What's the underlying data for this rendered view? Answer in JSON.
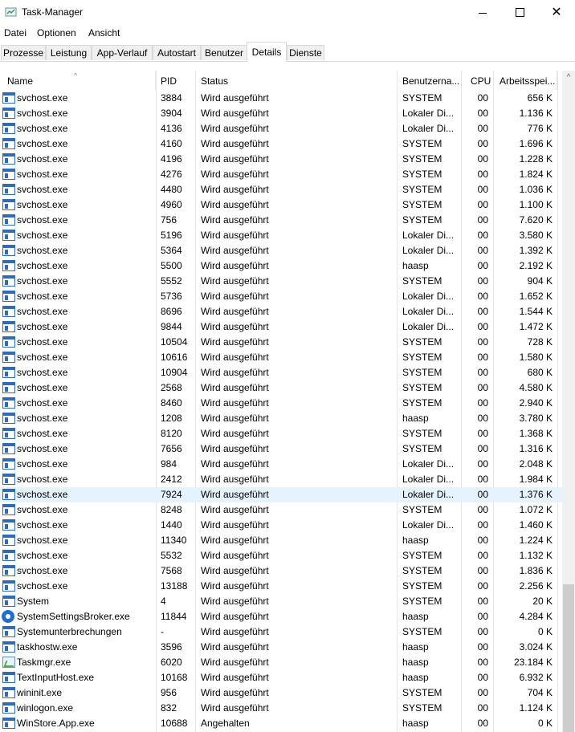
{
  "window": {
    "title": "Task-Manager",
    "app_icon": "task-manager-icon"
  },
  "menu": [
    "Datei",
    "Optionen",
    "Ansicht"
  ],
  "tabs": [
    "Prozesse",
    "Leistung",
    "App-Verlauf",
    "Autostart",
    "Benutzer",
    "Details",
    "Dienste"
  ],
  "active_tab": "Details",
  "columns": {
    "name": "Name",
    "pid": "PID",
    "status": "Status",
    "user": "Benutzerna...",
    "cpu": "CPU",
    "memory": "Arbeitsspei..."
  },
  "colors": {
    "selected_row": "#e5f3ff",
    "icon_blue": "#2f6cb5"
  },
  "rows": [
    {
      "name": "svchost.exe",
      "pid": "3884",
      "status": "Wird ausgeführt",
      "user": "SYSTEM",
      "cpu": "00",
      "mem": "656 K",
      "icon": "window-icon"
    },
    {
      "name": "svchost.exe",
      "pid": "3904",
      "status": "Wird ausgeführt",
      "user": "Lokaler Di...",
      "cpu": "00",
      "mem": "1.136 K",
      "icon": "window-icon"
    },
    {
      "name": "svchost.exe",
      "pid": "4136",
      "status": "Wird ausgeführt",
      "user": "Lokaler Di...",
      "cpu": "00",
      "mem": "776 K",
      "icon": "window-icon"
    },
    {
      "name": "svchost.exe",
      "pid": "4160",
      "status": "Wird ausgeführt",
      "user": "SYSTEM",
      "cpu": "00",
      "mem": "1.696 K",
      "icon": "window-icon"
    },
    {
      "name": "svchost.exe",
      "pid": "4196",
      "status": "Wird ausgeführt",
      "user": "SYSTEM",
      "cpu": "00",
      "mem": "1.228 K",
      "icon": "window-icon"
    },
    {
      "name": "svchost.exe",
      "pid": "4276",
      "status": "Wird ausgeführt",
      "user": "SYSTEM",
      "cpu": "00",
      "mem": "1.824 K",
      "icon": "window-icon"
    },
    {
      "name": "svchost.exe",
      "pid": "4480",
      "status": "Wird ausgeführt",
      "user": "SYSTEM",
      "cpu": "00",
      "mem": "1.036 K",
      "icon": "window-icon"
    },
    {
      "name": "svchost.exe",
      "pid": "4960",
      "status": "Wird ausgeführt",
      "user": "SYSTEM",
      "cpu": "00",
      "mem": "1.100 K",
      "icon": "window-icon"
    },
    {
      "name": "svchost.exe",
      "pid": "756",
      "status": "Wird ausgeführt",
      "user": "SYSTEM",
      "cpu": "00",
      "mem": "7.620 K",
      "icon": "window-icon"
    },
    {
      "name": "svchost.exe",
      "pid": "5196",
      "status": "Wird ausgeführt",
      "user": "Lokaler Di...",
      "cpu": "00",
      "mem": "3.580 K",
      "icon": "window-icon"
    },
    {
      "name": "svchost.exe",
      "pid": "5364",
      "status": "Wird ausgeführt",
      "user": "Lokaler Di...",
      "cpu": "00",
      "mem": "1.392 K",
      "icon": "window-icon"
    },
    {
      "name": "svchost.exe",
      "pid": "5500",
      "status": "Wird ausgeführt",
      "user": "haasp",
      "cpu": "00",
      "mem": "2.192 K",
      "icon": "window-icon"
    },
    {
      "name": "svchost.exe",
      "pid": "5552",
      "status": "Wird ausgeführt",
      "user": "SYSTEM",
      "cpu": "00",
      "mem": "904 K",
      "icon": "window-icon"
    },
    {
      "name": "svchost.exe",
      "pid": "5736",
      "status": "Wird ausgeführt",
      "user": "Lokaler Di...",
      "cpu": "00",
      "mem": "1.652 K",
      "icon": "window-icon"
    },
    {
      "name": "svchost.exe",
      "pid": "8696",
      "status": "Wird ausgeführt",
      "user": "Lokaler Di...",
      "cpu": "00",
      "mem": "1.544 K",
      "icon": "window-icon"
    },
    {
      "name": "svchost.exe",
      "pid": "9844",
      "status": "Wird ausgeführt",
      "user": "Lokaler Di...",
      "cpu": "00",
      "mem": "1.472 K",
      "icon": "window-icon"
    },
    {
      "name": "svchost.exe",
      "pid": "10504",
      "status": "Wird ausgeführt",
      "user": "SYSTEM",
      "cpu": "00",
      "mem": "728 K",
      "icon": "window-icon"
    },
    {
      "name": "svchost.exe",
      "pid": "10616",
      "status": "Wird ausgeführt",
      "user": "SYSTEM",
      "cpu": "00",
      "mem": "1.580 K",
      "icon": "window-icon"
    },
    {
      "name": "svchost.exe",
      "pid": "10904",
      "status": "Wird ausgeführt",
      "user": "SYSTEM",
      "cpu": "00",
      "mem": "680 K",
      "icon": "window-icon"
    },
    {
      "name": "svchost.exe",
      "pid": "2568",
      "status": "Wird ausgeführt",
      "user": "SYSTEM",
      "cpu": "00",
      "mem": "4.580 K",
      "icon": "window-icon"
    },
    {
      "name": "svchost.exe",
      "pid": "8460",
      "status": "Wird ausgeführt",
      "user": "SYSTEM",
      "cpu": "00",
      "mem": "2.940 K",
      "icon": "window-icon"
    },
    {
      "name": "svchost.exe",
      "pid": "1208",
      "status": "Wird ausgeführt",
      "user": "haasp",
      "cpu": "00",
      "mem": "3.780 K",
      "icon": "window-icon"
    },
    {
      "name": "svchost.exe",
      "pid": "8120",
      "status": "Wird ausgeführt",
      "user": "SYSTEM",
      "cpu": "00",
      "mem": "1.368 K",
      "icon": "window-icon"
    },
    {
      "name": "svchost.exe",
      "pid": "7656",
      "status": "Wird ausgeführt",
      "user": "SYSTEM",
      "cpu": "00",
      "mem": "1.316 K",
      "icon": "window-icon"
    },
    {
      "name": "svchost.exe",
      "pid": "984",
      "status": "Wird ausgeführt",
      "user": "Lokaler Di...",
      "cpu": "00",
      "mem": "2.048 K",
      "icon": "window-icon"
    },
    {
      "name": "svchost.exe",
      "pid": "2412",
      "status": "Wird ausgeführt",
      "user": "Lokaler Di...",
      "cpu": "00",
      "mem": "1.984 K",
      "icon": "window-icon"
    },
    {
      "name": "svchost.exe",
      "pid": "7924",
      "status": "Wird ausgeführt",
      "user": "Lokaler Di...",
      "cpu": "00",
      "mem": "1.376 K",
      "icon": "window-icon",
      "selected": true
    },
    {
      "name": "svchost.exe",
      "pid": "8248",
      "status": "Wird ausgeführt",
      "user": "SYSTEM",
      "cpu": "00",
      "mem": "1.072 K",
      "icon": "window-icon"
    },
    {
      "name": "svchost.exe",
      "pid": "1440",
      "status": "Wird ausgeführt",
      "user": "Lokaler Di...",
      "cpu": "00",
      "mem": "1.460 K",
      "icon": "window-icon"
    },
    {
      "name": "svchost.exe",
      "pid": "11340",
      "status": "Wird ausgeführt",
      "user": "haasp",
      "cpu": "00",
      "mem": "1.224 K",
      "icon": "window-icon"
    },
    {
      "name": "svchost.exe",
      "pid": "5532",
      "status": "Wird ausgeführt",
      "user": "SYSTEM",
      "cpu": "00",
      "mem": "1.132 K",
      "icon": "window-icon"
    },
    {
      "name": "svchost.exe",
      "pid": "7568",
      "status": "Wird ausgeführt",
      "user": "SYSTEM",
      "cpu": "00",
      "mem": "1.836 K",
      "icon": "window-icon"
    },
    {
      "name": "svchost.exe",
      "pid": "13188",
      "status": "Wird ausgeführt",
      "user": "SYSTEM",
      "cpu": "00",
      "mem": "2.256 K",
      "icon": "window-icon"
    },
    {
      "name": "System",
      "pid": "4",
      "status": "Wird ausgeführt",
      "user": "SYSTEM",
      "cpu": "00",
      "mem": "20 K",
      "icon": "window-icon"
    },
    {
      "name": "SystemSettingsBroker.exe",
      "pid": "11844",
      "status": "Wird ausgeführt",
      "user": "haasp",
      "cpu": "00",
      "mem": "4.284 K",
      "icon": "gear-icon"
    },
    {
      "name": "Systemunterbrechungen",
      "pid": "-",
      "status": "Wird ausgeführt",
      "user": "SYSTEM",
      "cpu": "00",
      "mem": "0 K",
      "icon": "window-icon"
    },
    {
      "name": "taskhostw.exe",
      "pid": "3596",
      "status": "Wird ausgeführt",
      "user": "haasp",
      "cpu": "00",
      "mem": "3.024 K",
      "icon": "window-icon"
    },
    {
      "name": "Taskmgr.exe",
      "pid": "6020",
      "status": "Wird ausgeführt",
      "user": "haasp",
      "cpu": "00",
      "mem": "23.184 K",
      "icon": "task-manager-icon"
    },
    {
      "name": "TextInputHost.exe",
      "pid": "10168",
      "status": "Wird ausgeführt",
      "user": "haasp",
      "cpu": "00",
      "mem": "6.932 K",
      "icon": "window-icon"
    },
    {
      "name": "wininit.exe",
      "pid": "956",
      "status": "Wird ausgeführt",
      "user": "SYSTEM",
      "cpu": "00",
      "mem": "704 K",
      "icon": "window-icon"
    },
    {
      "name": "winlogon.exe",
      "pid": "832",
      "status": "Wird ausgeführt",
      "user": "SYSTEM",
      "cpu": "00",
      "mem": "1.124 K",
      "icon": "window-icon"
    },
    {
      "name": "WinStore.App.exe",
      "pid": "10688",
      "status": "Angehalten",
      "user": "haasp",
      "cpu": "00",
      "mem": "0 K",
      "icon": "window-icon"
    }
  ]
}
